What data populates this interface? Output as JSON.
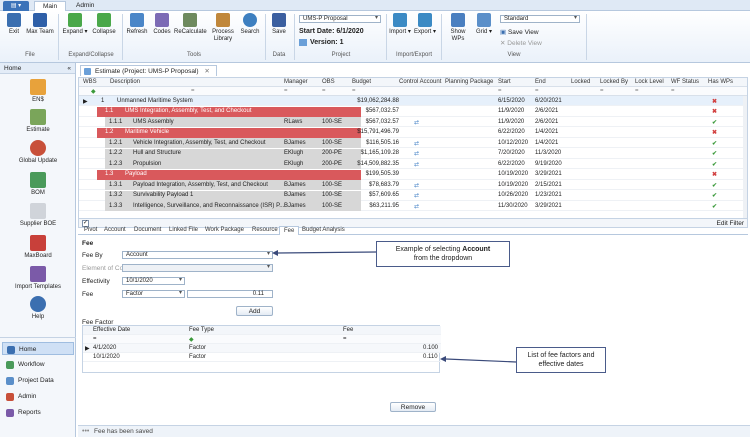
{
  "ribbon": {
    "app_menu": "▤ ▾",
    "tabs": [
      "Main",
      "Admin"
    ],
    "buttons": {
      "exit": "Exit",
      "max_team": "Max Team",
      "expand": "Expand",
      "collapse": "Collapse",
      "refresh": "Refresh",
      "codes": "Codes",
      "recalculate": "ReCalculate",
      "process_library": "Process Library",
      "search": "Search",
      "save": "Save",
      "import": "Import",
      "export": "Export",
      "show_wps": "Show WPs",
      "grid": "Grid",
      "save_view": "Save View",
      "delete_view": "Delete View"
    },
    "groups": {
      "file": "File",
      "expand_collapse": "Expand/Collapse",
      "tools": "Tools",
      "data": "Data",
      "project": "Project",
      "import_export": "Import/Export",
      "view": "View"
    },
    "project_select": "UMS-P Proposal",
    "start_date": "Start Date: 6/1/2020",
    "version": "Version: 1",
    "view_select": "Standard"
  },
  "leftnav": {
    "home_label": "Home",
    "items": [
      "EN$",
      "Estimate",
      "Global Update",
      "BOM",
      "Supplier BOE",
      "MaxBoard",
      "Import Templates",
      "Help"
    ],
    "bottom": [
      "Home",
      "Workflow",
      "Project Data",
      "Admin",
      "Reports"
    ]
  },
  "doc_tab": "Estimate (Project: UMS-P Proposal)",
  "grid": {
    "columns": [
      "WBS",
      "Description",
      "Manager",
      "OBS",
      "Budget",
      "Control Account",
      "Planning Package",
      "Start",
      "End",
      "Locked",
      "Locked By",
      "Lock Level",
      "WF Status",
      "Has WPs"
    ],
    "rows": [
      {
        "wbs": "1",
        "desc": "Unmanned Maritime System",
        "mgr": "",
        "obs": "",
        "budget": "$19,062,284.88",
        "start": "6/15/2020",
        "end": "6/20/2021",
        "wp": "✖"
      },
      {
        "wbs": "1.1",
        "desc": "UMS Integration, Assembly, Test, and Checkout",
        "mgr": "",
        "obs": "",
        "budget": "$567,032.57",
        "start": "11/9/2020",
        "end": "2/6/2021",
        "wp": "✖"
      },
      {
        "wbs": "1.1.1",
        "desc": "UMS Assembly",
        "mgr": "RLaws",
        "obs": "100-SE",
        "budget": "$567,032.57",
        "start": "11/9/2020",
        "end": "2/6/2021",
        "wp": "✔"
      },
      {
        "wbs": "1.2",
        "desc": "Maritime Vehicle",
        "mgr": "",
        "obs": "",
        "budget": "$15,791,496.79",
        "start": "6/22/2020",
        "end": "1/4/2021",
        "wp": "✖"
      },
      {
        "wbs": "1.2.1",
        "desc": "Vehicle Integration, Assembly, Test, and Checkout",
        "mgr": "BJames",
        "obs": "100-SE",
        "budget": "$116,505.16",
        "start": "10/12/2020",
        "end": "1/4/2021",
        "wp": "✔"
      },
      {
        "wbs": "1.2.2",
        "desc": "Hull and Structure",
        "mgr": "EKlugh",
        "obs": "200-PE",
        "budget": "$1,165,109.28",
        "start": "7/20/2020",
        "end": "11/3/2020",
        "wp": "✔"
      },
      {
        "wbs": "1.2.3",
        "desc": "Propulsion",
        "mgr": "EKlugh",
        "obs": "200-PE",
        "budget": "$14,509,882.35",
        "start": "6/22/2020",
        "end": "9/19/2020",
        "wp": "✔"
      },
      {
        "wbs": "1.3",
        "desc": "Payload",
        "mgr": "",
        "obs": "",
        "budget": "$199,505.39",
        "start": "10/19/2020",
        "end": "3/29/2021",
        "wp": "✖"
      },
      {
        "wbs": "1.3.1",
        "desc": "Payload Integration, Assembly, Test, and Checkout",
        "mgr": "BJames",
        "obs": "100-SE",
        "budget": "$78,683.79",
        "start": "10/19/2020",
        "end": "2/15/2021",
        "wp": "✔"
      },
      {
        "wbs": "1.3.2",
        "desc": "Survivability Payload 1",
        "mgr": "BJames",
        "obs": "100-SE",
        "budget": "$57,609.65",
        "start": "10/26/2020",
        "end": "1/23/2021",
        "wp": "✔"
      },
      {
        "wbs": "1.3.3",
        "desc": "Intelligence, Surveillance, and Reconnaissance (ISR) P...",
        "mgr": "BJames",
        "obs": "100-SE",
        "budget": "$63,211.95",
        "start": "11/30/2020",
        "end": "3/29/2021",
        "wp": "✔"
      }
    ],
    "edit_filter": "Edit Filter"
  },
  "detail_tabs": [
    "Pivot",
    "Account",
    "Document",
    "Linked File",
    "Work Package",
    "Resource",
    "Fee",
    "Budget Analysis"
  ],
  "fee": {
    "section": "Fee",
    "fee_by_label": "Fee By",
    "fee_by_value": "Account",
    "element_label": "Element of Cost",
    "effectivity_label": "Effectivity",
    "effectivity_value": "10/1/2020",
    "fee_label": "Fee",
    "fee_type_value": "Factor",
    "fee_value": "0.11",
    "add_label": "Add",
    "factor_section": "Fee Factor",
    "factor_columns": [
      "Effective Date",
      "Fee Type",
      "Fee"
    ],
    "factors": [
      {
        "date": "4/1/2020",
        "type": "Factor",
        "fee": "0.100"
      },
      {
        "date": "10/1/2020",
        "type": "Factor",
        "fee": "0.110"
      }
    ],
    "remove_label": "Remove"
  },
  "callouts": {
    "account_pre": "Example of selecting ",
    "account_bold": "Account",
    "account_post": "from the dropdown",
    "list": "List of fee factors and effective dates"
  },
  "status": "Fee has been saved",
  "colors": {
    "accent": "#3b73b9",
    "red_row": "#d9595c",
    "gray_row": "#d7d7d7",
    "ok": "#3b9a3b",
    "no": "#d24040"
  }
}
